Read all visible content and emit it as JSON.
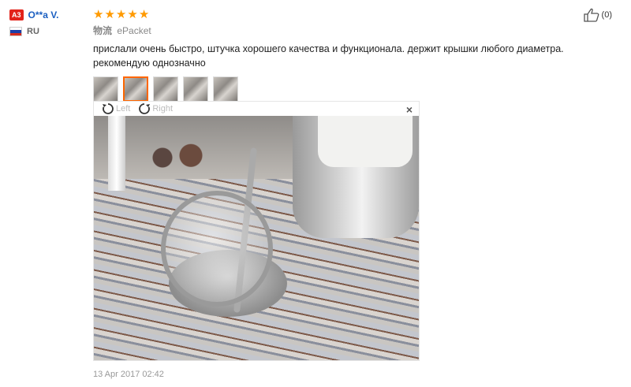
{
  "user": {
    "badge": "A3",
    "name": "O**a V.",
    "country": "RU"
  },
  "review": {
    "rating": 5,
    "shipping_logistics": "物流",
    "shipping_method": "ePacket",
    "text": "прислали очень быстро, штучка хорошего качества и функционала. держит крышки любого диаметра. рекомендую однозначно",
    "date": "13 Apr 2017 02:42"
  },
  "viewer": {
    "rotate_left_label": "Left",
    "rotate_right_label": "Right",
    "close_label": "×"
  },
  "like": {
    "count_label": "(0)"
  },
  "colors": {
    "star": "#ff9a00",
    "username": "#1b5fc1",
    "badge": "#e2231a",
    "active_thumb": "#ff6600"
  },
  "icons": [
    "star-icon",
    "thumbs-up-icon",
    "rotate-left-icon",
    "rotate-right-icon",
    "close-icon",
    "russia-flag-icon"
  ]
}
